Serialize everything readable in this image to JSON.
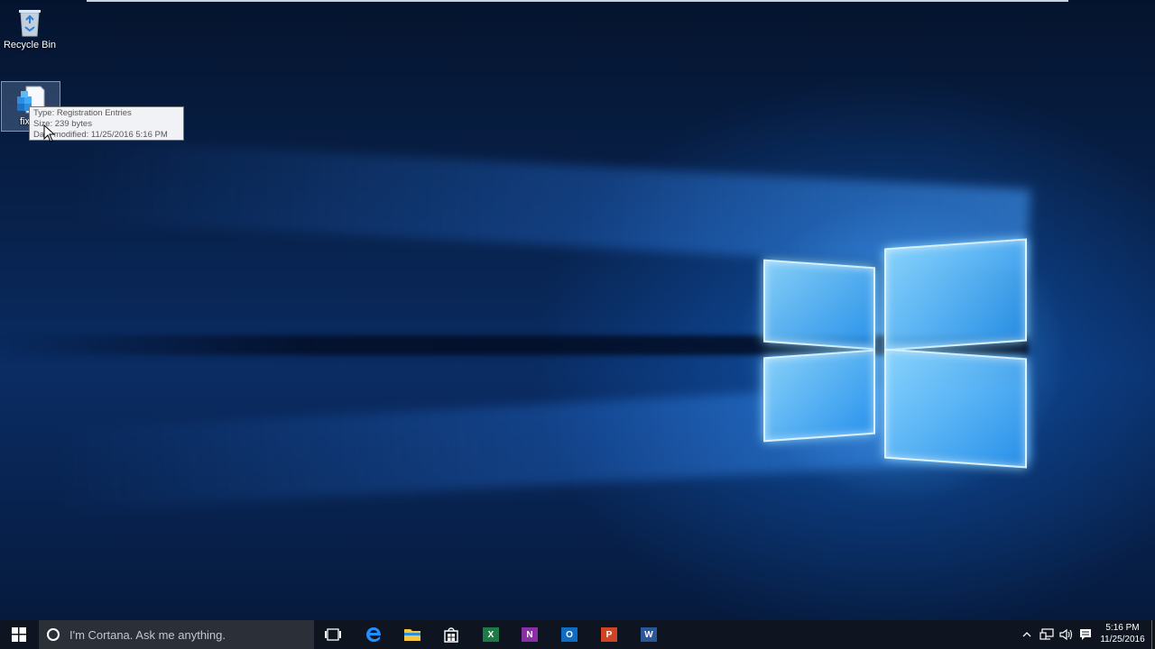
{
  "desktop": {
    "icons": [
      {
        "label": "Recycle Bin",
        "icon": "recycle-bin-icon"
      },
      {
        "label": "fix",
        "icon": "registry-file-icon"
      }
    ],
    "tooltip": {
      "type_line": "Type: Registration Entries",
      "size_line": "Size: 239 bytes",
      "date_line": "Date modified: 11/25/2016 5:16 PM"
    }
  },
  "taskbar": {
    "search_placeholder": "I'm Cortana. Ask me anything.",
    "apps": [
      {
        "name": "Task View",
        "icon": "task-view-icon"
      },
      {
        "name": "Microsoft Edge",
        "icon": "edge-icon",
        "color": "#1e90ff"
      },
      {
        "name": "File Explorer",
        "icon": "file-explorer-icon",
        "color": "#f4c542"
      },
      {
        "name": "Store",
        "icon": "store-icon",
        "color": "#ffffff"
      },
      {
        "name": "Excel",
        "icon": "excel-icon",
        "glyph": "X",
        "color": "#1d7a45"
      },
      {
        "name": "OneNote",
        "icon": "onenote-icon",
        "glyph": "N",
        "color": "#8a2fa5"
      },
      {
        "name": "Outlook",
        "icon": "outlook-icon",
        "glyph": "O",
        "color": "#0f6cc5"
      },
      {
        "name": "PowerPoint",
        "icon": "powerpoint-icon",
        "glyph": "P",
        "color": "#d04423"
      },
      {
        "name": "Word",
        "icon": "word-icon",
        "glyph": "W",
        "color": "#2b579a"
      }
    ],
    "clock": {
      "time": "5:16 PM",
      "date": "11/25/2016"
    }
  }
}
